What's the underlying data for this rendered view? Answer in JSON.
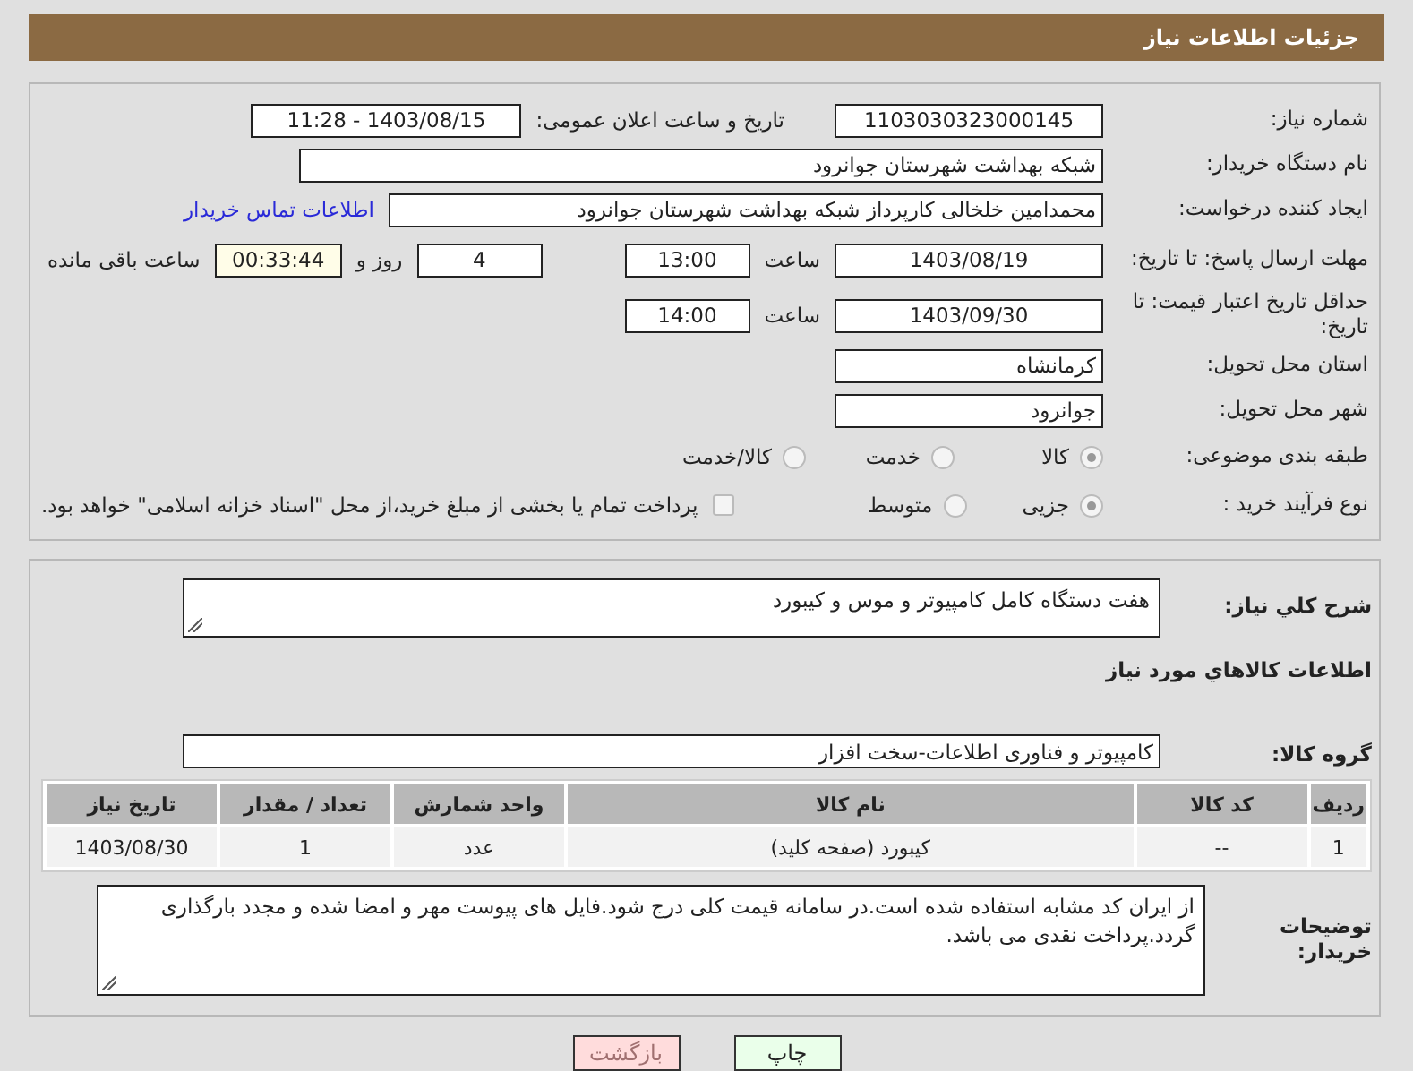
{
  "header": {
    "title": "جزئیات اطلاعات نیاز"
  },
  "need_number": {
    "label": "شماره نیاز:",
    "value": "1103030323000145"
  },
  "announce": {
    "label": "تاریخ و ساعت اعلان عمومی:",
    "value": "1403/08/15 - 11:28"
  },
  "buyer_org": {
    "label": "نام دستگاه خریدار:",
    "value": "شبکه بهداشت شهرستان جوانرود"
  },
  "creator": {
    "label": "ایجاد کننده درخواست:",
    "value": "محمدامین خلخالی کارپرداز شبکه بهداشت شهرستان جوانرود",
    "link": "اطلاعات تماس خریدار"
  },
  "deadline": {
    "label": "مهلت ارسال پاسخ: تا تاریخ:",
    "date": "1403/08/19",
    "time_label": "ساعت",
    "time": "13:00",
    "days": "4",
    "days_label": "روز و",
    "remaining": "00:33:44",
    "remaining_label": "ساعت باقی مانده"
  },
  "validity": {
    "label": "حداقل تاریخ اعتبار قیمت: تا تاریخ:",
    "date": "1403/09/30",
    "time_label": "ساعت",
    "time": "14:00"
  },
  "province": {
    "label": "استان محل تحویل:",
    "value": "کرمانشاه"
  },
  "city": {
    "label": "شهر محل تحویل:",
    "value": "جوانرود"
  },
  "category": {
    "label": "طبقه بندی موضوعی:",
    "options": [
      {
        "label": "کالا",
        "selected": true
      },
      {
        "label": "خدمت",
        "selected": false
      },
      {
        "label": "کالا/خدمت",
        "selected": false
      }
    ]
  },
  "process": {
    "label": "نوع فرآیند خرید :",
    "options": [
      {
        "label": "جزیی",
        "selected": true
      },
      {
        "label": "متوسط",
        "selected": false
      }
    ],
    "payment": {
      "label": "پرداخت تمام یا بخشی از مبلغ خرید،از محل \"اسناد خزانه اسلامی\" خواهد بود.",
      "checked": false
    }
  },
  "description": {
    "label": "شرح کلي نياز:",
    "value": "هفت دستگاه کامل کامپیوتر و موس و کیبورد"
  },
  "goods_title": "اطلاعات کالاهاي مورد نياز",
  "goods_group": {
    "label": "گروه کالا:",
    "value": "کامپیوتر و فناوری اطلاعات-سخت افزار"
  },
  "table": {
    "columns": [
      "ردیف",
      "کد کالا",
      "نام کالا",
      "واحد شمارش",
      "تعداد / مقدار",
      "تاریخ نیاز"
    ],
    "rows": [
      [
        "1",
        "--",
        "کیبورد (صفحه کلید)",
        "عدد",
        "1",
        "1403/08/30"
      ]
    ]
  },
  "notes": {
    "label": "توضیحات خریدار:",
    "value": "از ایران کد مشابه استفاده شده است.در سامانه قیمت کلی درج شود.فایل های پیوست مهر و امضا شده و مجدد بارگذاری گردد.پرداخت نقدی می باشد."
  },
  "buttons": [
    {
      "label": "چاپ",
      "kind": "print"
    },
    {
      "label": "بازگشت",
      "kind": "back"
    }
  ]
}
